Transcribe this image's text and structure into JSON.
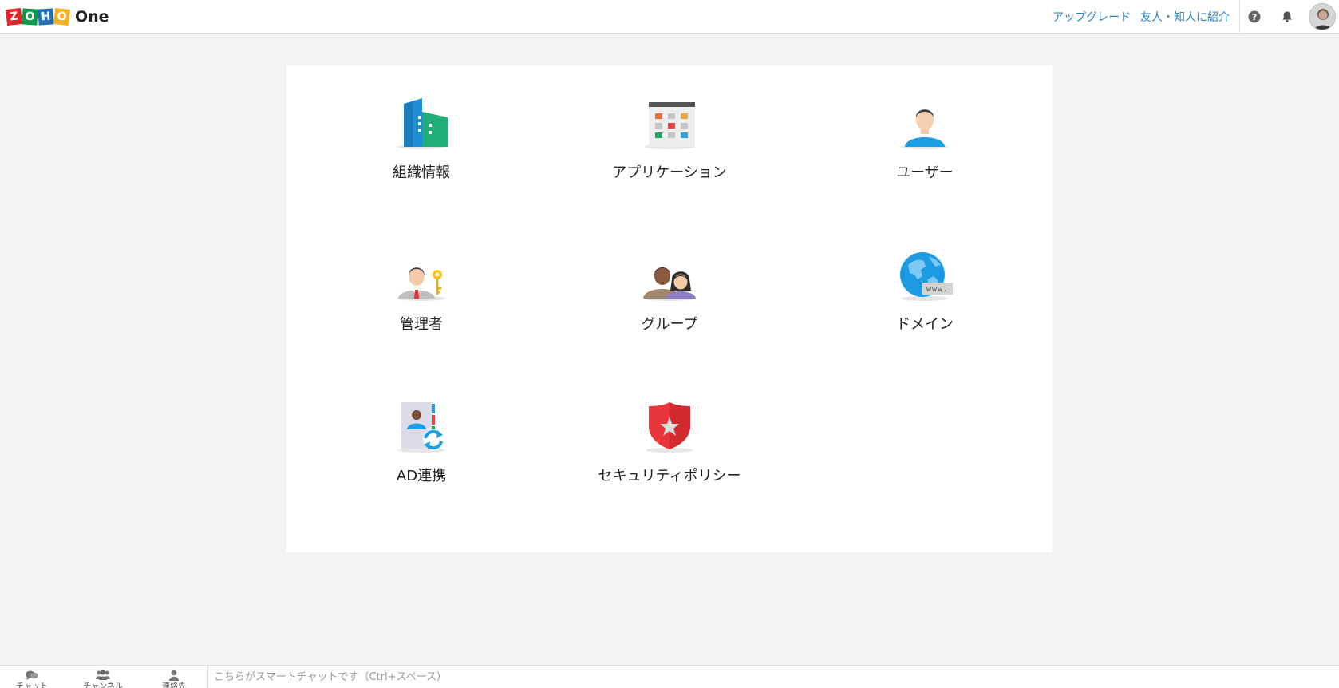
{
  "header": {
    "logo_letters": [
      "Z",
      "O",
      "H",
      "O"
    ],
    "logo_colors": [
      "#e42527",
      "#089949",
      "#226db4",
      "#f9b21d"
    ],
    "product_name": "One",
    "upgrade_label": "アップグレード",
    "refer_label": "友人・知人に紹介",
    "help_icon": "help-icon",
    "bell_icon": "bell-icon",
    "link_color": "#2a84c6"
  },
  "tiles": [
    {
      "label": "組織情報",
      "icon": "organization-building-icon"
    },
    {
      "label": "アプリケーション",
      "icon": "applications-grid-icon"
    },
    {
      "label": "ユーザー",
      "icon": "user-icon"
    },
    {
      "label": "管理者",
      "icon": "admin-key-icon"
    },
    {
      "label": "グループ",
      "icon": "group-icon"
    },
    {
      "label": "ドメイン",
      "icon": "domain-globe-icon"
    },
    {
      "label": "AD連携",
      "icon": "ad-sync-icon"
    },
    {
      "label": "セキュリティポリシー",
      "icon": "security-shield-icon"
    }
  ],
  "bottom_bar": {
    "tabs": [
      {
        "label": "チャット",
        "icon": "chat-icon"
      },
      {
        "label": "チャンネル",
        "icon": "channels-icon"
      },
      {
        "label": "連絡先",
        "icon": "contacts-icon"
      }
    ],
    "smart_chat_placeholder": "こちらがスマートチャットです（Ctrl+スペース）"
  }
}
